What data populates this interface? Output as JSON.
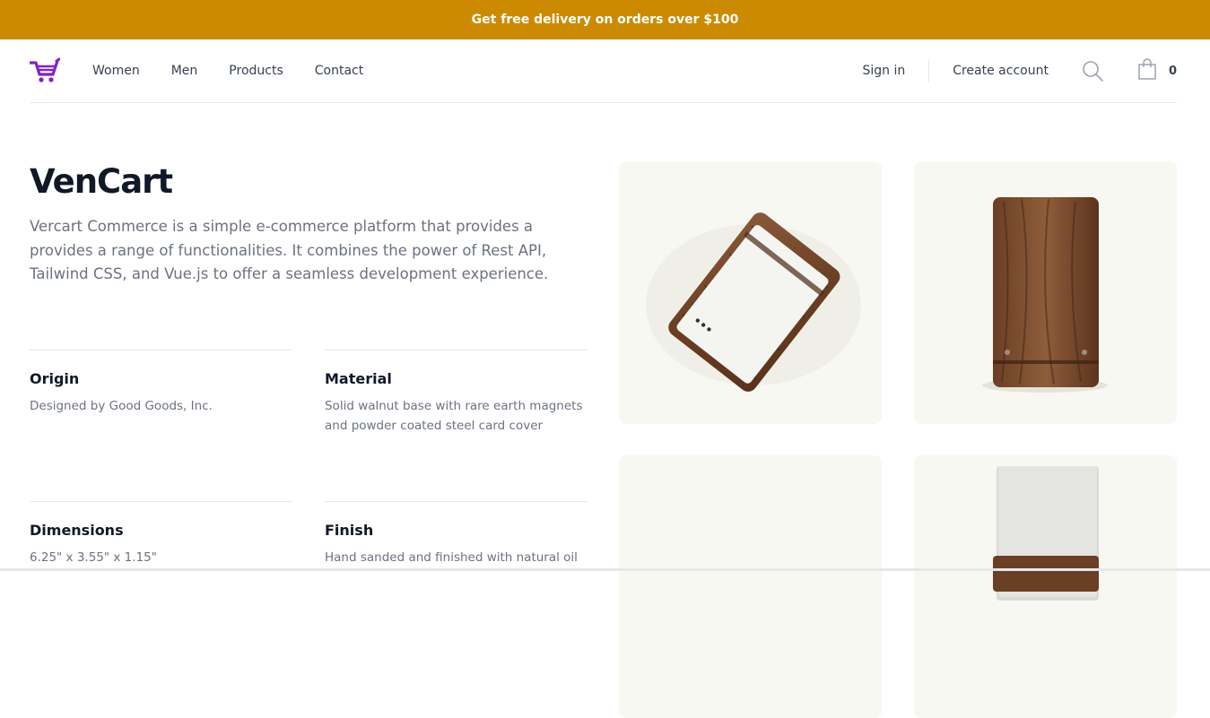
{
  "banner": {
    "text": "Get free delivery on orders over $100",
    "color": "#cc8a00"
  },
  "brand": {
    "accent": "#7e22ce",
    "logo_icon": "cart-logo-icon"
  },
  "nav": {
    "links": [
      "Women",
      "Men",
      "Products",
      "Contact"
    ],
    "sign_in": "Sign in",
    "create_account": "Create account",
    "cart_count": "0",
    "icons": [
      "search-icon",
      "shopping-bag-icon"
    ]
  },
  "product": {
    "title": "VenCart",
    "description": "Vercart Commerce is a simple e-commerce platform that provides a provides a range of functionalities. It combines the power of Rest API, Tailwind CSS, and Vue.js to offer a seamless development experience.",
    "features": [
      {
        "name": "Origin",
        "value": "Designed by Good Goods, Inc."
      },
      {
        "name": "Material",
        "value": "Solid walnut base with rare earth magnets and powder coated steel card cover"
      },
      {
        "name": "Dimensions",
        "value": "6.25\" x 3.55\" x 1.15\""
      },
      {
        "name": "Finish",
        "value": "Hand sanded and finished with natural oil"
      }
    ]
  },
  "gallery": {
    "images": [
      "walnut card holder angled with white card",
      "walnut card holder front view",
      "empty product tile",
      "walnut card holder with card standing"
    ]
  }
}
